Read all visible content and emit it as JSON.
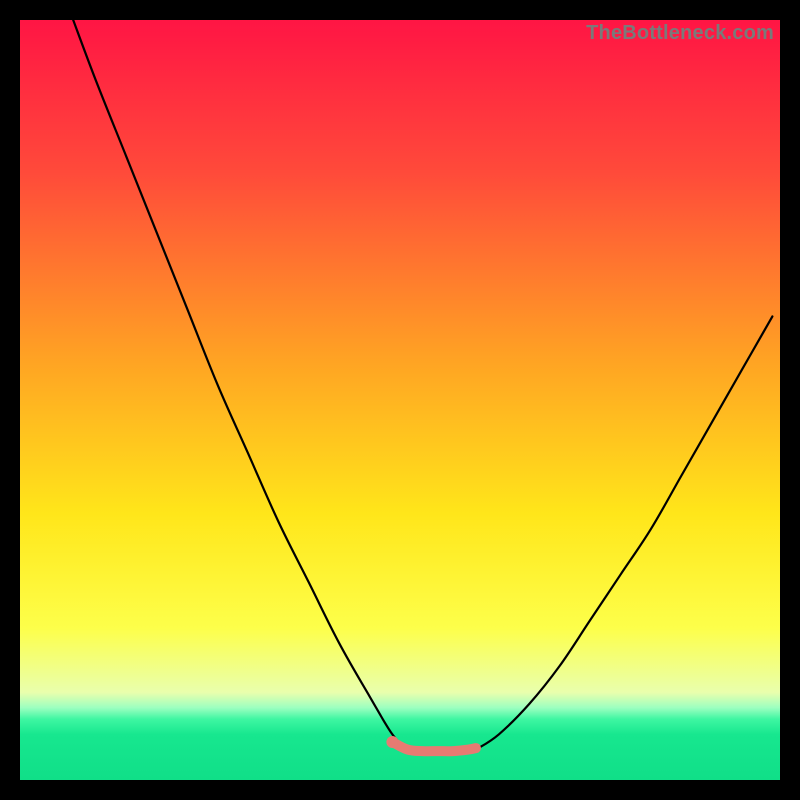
{
  "watermark": "TheBottleneck.com",
  "chart_data": {
    "type": "line",
    "title": "",
    "xlabel": "",
    "ylabel": "",
    "xlim": [
      0,
      100
    ],
    "ylim": [
      0,
      100
    ],
    "grid": false,
    "legend": false,
    "background_gradient_stops": [
      {
        "pos": 0.0,
        "color": "#ff1544"
      },
      {
        "pos": 0.2,
        "color": "#ff4a3a"
      },
      {
        "pos": 0.45,
        "color": "#ffa423"
      },
      {
        "pos": 0.65,
        "color": "#ffe61a"
      },
      {
        "pos": 0.8,
        "color": "#fdff4a"
      },
      {
        "pos": 0.885,
        "color": "#e9ffad"
      },
      {
        "pos": 0.905,
        "color": "#9cffc0"
      },
      {
        "pos": 0.92,
        "color": "#3ef6a2"
      },
      {
        "pos": 0.94,
        "color": "#17e78f"
      },
      {
        "pos": 1.0,
        "color": "#10df88"
      }
    ],
    "series": [
      {
        "name": "left-curve",
        "stroke": "#000000",
        "x": [
          7,
          10,
          14,
          18,
          22,
          26,
          30,
          34,
          38,
          42,
          46,
          49,
          51
        ],
        "y": [
          100,
          92,
          82,
          72,
          62,
          52,
          43,
          34,
          26,
          18,
          11,
          6,
          4
        ]
      },
      {
        "name": "right-curve",
        "stroke": "#000000",
        "x": [
          60,
          63,
          67,
          71,
          75,
          79,
          83,
          87,
          91,
          95,
          99
        ],
        "y": [
          4,
          6,
          10,
          15,
          21,
          27,
          33,
          40,
          47,
          54,
          61
        ]
      },
      {
        "name": "bottom-segment",
        "stroke": "#e77b72",
        "x": [
          49,
          51,
          53,
          55,
          57,
          59,
          60
        ],
        "y": [
          5,
          4,
          3.8,
          3.8,
          3.8,
          4,
          4.2
        ]
      }
    ],
    "markers": [
      {
        "name": "left-dot",
        "x": 49,
        "y": 5,
        "color": "#e77b72"
      }
    ]
  }
}
